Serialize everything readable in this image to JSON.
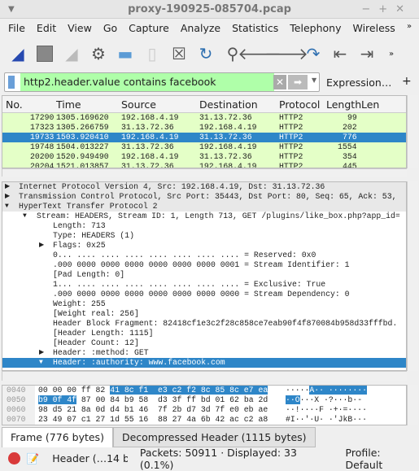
{
  "window": {
    "title": "proxy-190925-085704.pcap"
  },
  "menu": [
    "File",
    "Edit",
    "View",
    "Go",
    "Capture",
    "Analyze",
    "Statistics",
    "Telephony",
    "Wireless"
  ],
  "filter": {
    "value": "http2.header.value contains facebook",
    "expression_label": "Expression…",
    "add_label": "+"
  },
  "packet_list": {
    "columns": [
      "No.",
      "Time",
      "Source",
      "Destination",
      "Protocol",
      "Length",
      "Len"
    ],
    "rows": [
      [
        "17290",
        "1305.169620",
        "192.168.4.19",
        "31.13.72.36",
        "HTTP2",
        "99"
      ],
      [
        "17323",
        "1305.266759",
        "31.13.72.36",
        "192.168.4.19",
        "HTTP2",
        "202"
      ],
      [
        "19733",
        "1503.920410",
        "192.168.4.19",
        "31.13.72.36",
        "HTTP2",
        "776"
      ],
      [
        "19748",
        "1504.013227",
        "31.13.72.36",
        "192.168.4.19",
        "HTTP2",
        "1554"
      ],
      [
        "20200",
        "1520.949490",
        "192.168.4.19",
        "31.13.72.36",
        "HTTP2",
        "354"
      ],
      [
        "20204",
        "1521.013857",
        "31.13.72.36",
        "192.168.4.19",
        "HTTP2",
        "445"
      ]
    ],
    "selected_index": 2
  },
  "details": [
    "Internet Protocol Version 4, Src: 192.168.4.19, Dst: 31.13.72.36",
    "Transmission Control Protocol, Src Port: 35443, Dst Port: 80, Seq: 65, Ack: 53,",
    "HyperText Transfer Protocol 2",
    "Stream: HEADERS, Stream ID: 1, Length 713, GET /plugins/like_box.php?app_id=",
    "Length: 713",
    "Type: HEADERS (1)",
    "Flags: 0x25",
    "0... .... .... .... .... .... .... .... = Reserved: 0x0",
    ".000 0000 0000 0000 0000 0000 0000 0001 = Stream Identifier: 1",
    "[Pad Length: 0]",
    "1... .... .... .... .... .... .... .... = Exclusive: True",
    ".000 0000 0000 0000 0000 0000 0000 0000 = Stream Dependency: 0",
    "Weight: 255",
    "[Weight real: 256]",
    "Header Block Fragment: 82418cf1e3c2f28c858ce7eab90f4f870084b958d33fffbd.",
    "[Header Length: 1115]",
    "[Header Count: 12]",
    "Header: :method: GET",
    "Header: :authority: www.facebook.com"
  ],
  "bytes": [
    {
      "off": "0040",
      "pre": "00 00 00 ff 82 ",
      "sel": "41 8c f1  e3 c2 f2 8c 85 8c e7 ea",
      "post": "",
      "apre": "·····",
      "asel": "A·· ········",
      "apost": ""
    },
    {
      "off": "0050",
      "pre": "",
      "sel": "b9 0f 4f",
      "post": " 87 00 84 b9 58  d3 3f ff bd 01 62 ba 2d",
      "apre": "",
      "asel": "··O",
      "apost": "···X ·?···b·-"
    },
    {
      "off": "0060",
      "pre": "98 d5 21 8a 0d d4 b1 46  7f 2b d7 3d 7f e0 eb ae",
      "sel": "",
      "post": "",
      "apre": "··!····F ·+·=····",
      "asel": "",
      "apost": ""
    },
    {
      "off": "0070",
      "pre": "23 49 07 c1 27 1d 55 16  88 27 4a 6b 42 ac c2 a8",
      "sel": "",
      "post": "",
      "apre": "#I··'·U· ·'JkB···",
      "asel": "",
      "apost": ""
    }
  ],
  "tabs": [
    "Frame (776 bytes)",
    "Decompressed Header (1115 bytes)"
  ],
  "status": {
    "field": "Header (…14 byte",
    "packets": "Packets: 50911 · Displayed: 33 (0.1%)",
    "profile": "Profile: Default"
  },
  "colors": {
    "selection": "#2e86c8",
    "filter_ok": "#afffa9",
    "row_bg": "#e4ffc7"
  }
}
